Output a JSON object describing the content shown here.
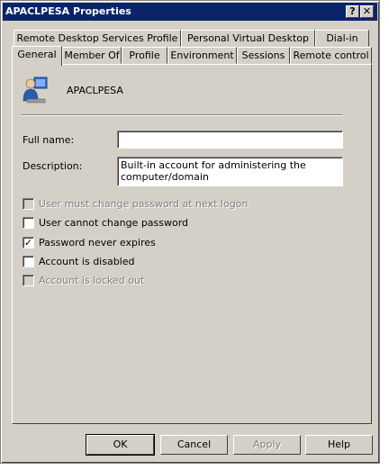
{
  "window": {
    "title": "APACLPESA Properties",
    "help_glyph": "?",
    "close_glyph": "✕"
  },
  "tabs_row1": [
    {
      "label": "Remote Desktop Services Profile"
    },
    {
      "label": "Personal Virtual Desktop"
    },
    {
      "label": "Dial-in"
    }
  ],
  "tabs_row2": [
    {
      "label": "General",
      "active": true
    },
    {
      "label": "Member Of"
    },
    {
      "label": "Profile"
    },
    {
      "label": "Environment"
    },
    {
      "label": "Sessions"
    },
    {
      "label": "Remote control"
    }
  ],
  "general": {
    "icon": "user-icon",
    "username": "APACLPESA",
    "full_name_label": "Full name:",
    "full_name_value": "",
    "description_label": "Description:",
    "description_value": "Built-in account for administering the computer/domain",
    "options": [
      {
        "label": "User must change password at next logon",
        "checked": false,
        "enabled": false
      },
      {
        "label": "User cannot change password",
        "checked": false,
        "enabled": true
      },
      {
        "label": "Password never expires",
        "checked": true,
        "enabled": true
      },
      {
        "label": "Account is disabled",
        "checked": false,
        "enabled": true
      },
      {
        "label": "Account is locked out",
        "checked": false,
        "enabled": false
      }
    ]
  },
  "buttons": {
    "ok": "OK",
    "cancel": "Cancel",
    "apply": "Apply",
    "help": "Help"
  },
  "colors": {
    "titlebar": "#0a246a",
    "face": "#d4d0c8"
  }
}
